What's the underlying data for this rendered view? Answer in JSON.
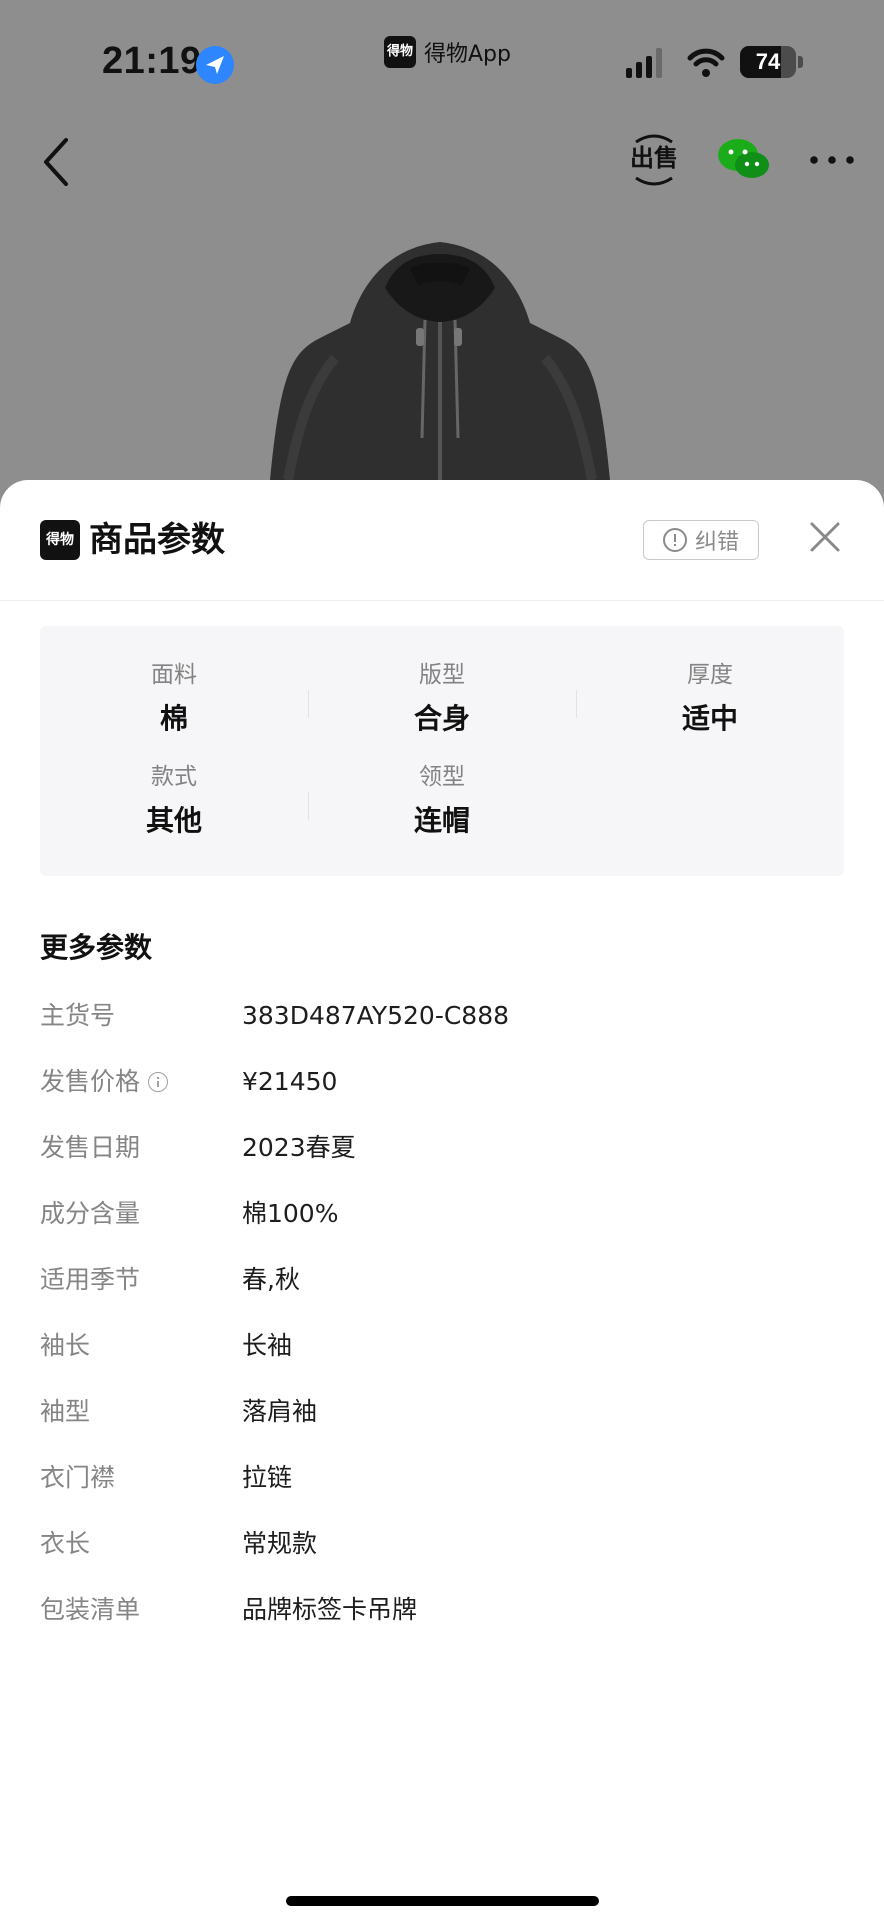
{
  "status_bar": {
    "time": "21:19",
    "app_name": "得物App",
    "app_logo_text": "得物",
    "battery_level": 74,
    "battery_label": "74"
  },
  "top_nav": {
    "back": "back",
    "sell_label": "出售",
    "share_icon": "wechat-icon",
    "more": "more"
  },
  "sheet": {
    "logo_text": "得物",
    "title": "商品参数",
    "report_error_label": "纠错",
    "close": "close"
  },
  "params": [
    {
      "label": "面料",
      "value": "棉"
    },
    {
      "label": "版型",
      "value": "合身"
    },
    {
      "label": "厚度",
      "value": "适中"
    },
    {
      "label": "款式",
      "value": "其他"
    },
    {
      "label": "领型",
      "value": "连帽"
    }
  ],
  "more_params": {
    "title": "更多参数",
    "rows": [
      {
        "label": "主货号",
        "value": "383D487AY520-C888",
        "has_info": false
      },
      {
        "label": "发售价格",
        "value": "¥21450",
        "has_info": true
      },
      {
        "label": "发售日期",
        "value": "2023春夏",
        "has_info": false
      },
      {
        "label": "成分含量",
        "value": "棉100%",
        "has_info": false
      },
      {
        "label": "适用季节",
        "value": "春,秋",
        "has_info": false
      },
      {
        "label": "袖长",
        "value": "长袖",
        "has_info": false
      },
      {
        "label": "袖型",
        "value": "落肩袖",
        "has_info": false
      },
      {
        "label": "衣门襟",
        "value": "拉链",
        "has_info": false
      },
      {
        "label": "衣长",
        "value": "常规款",
        "has_info": false
      },
      {
        "label": "包装清单",
        "value": "品牌标签卡吊牌",
        "has_info": false
      }
    ]
  },
  "colors": {
    "backdrop": "#8e8e8e",
    "location_blue": "#2e86ff",
    "wechat_green": "#1aad19",
    "label_gray": "#838383",
    "value_dark": "#111111",
    "card_bg": "#f6f6f8"
  }
}
